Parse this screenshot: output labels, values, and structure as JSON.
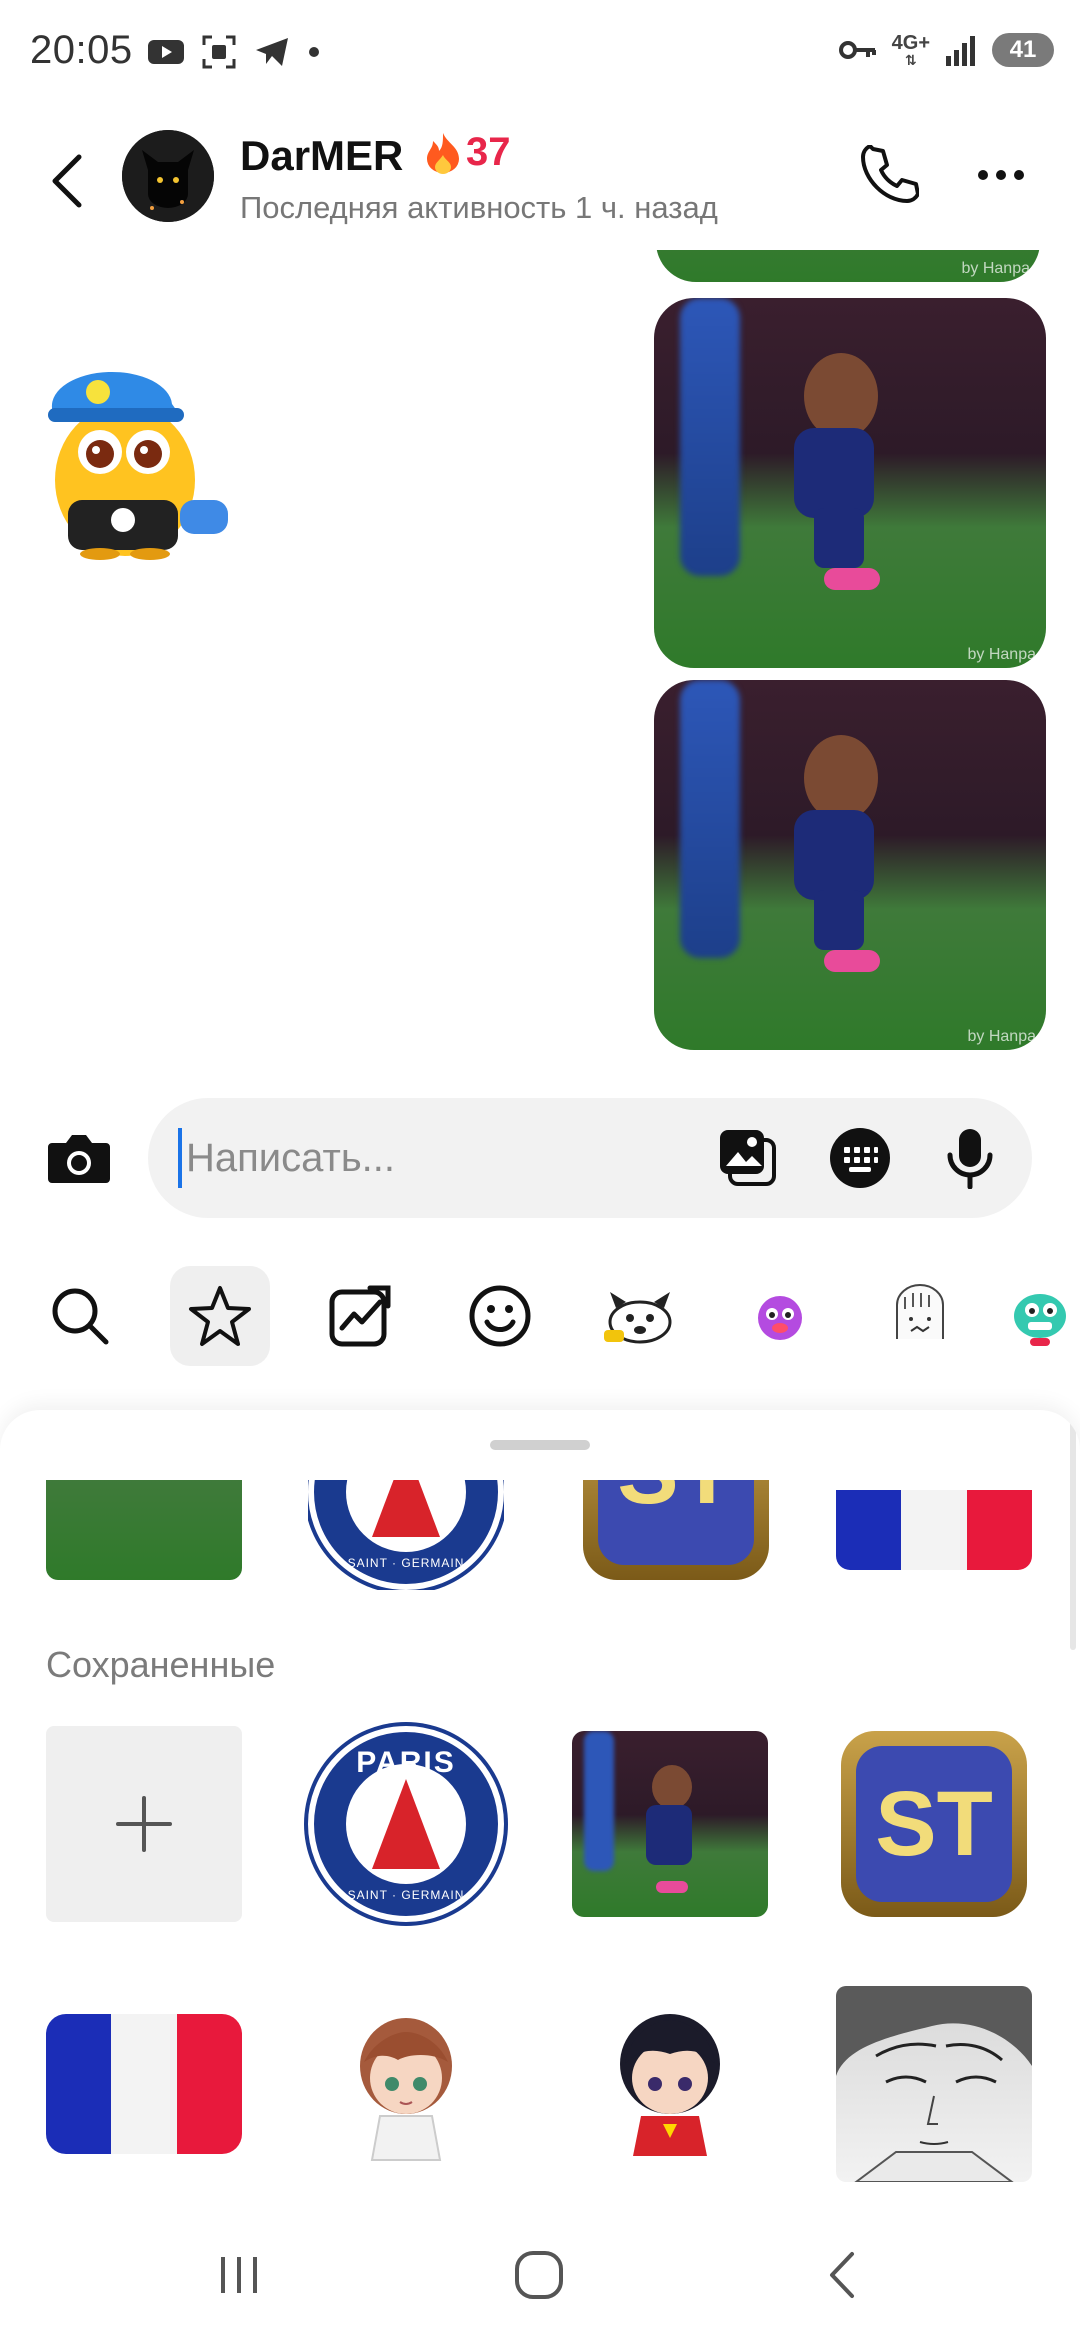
{
  "status_bar": {
    "time": "20:05",
    "network": "4G+",
    "battery": "41"
  },
  "header": {
    "username": "DarMER",
    "streak_count": "37",
    "last_seen": "Последняя активность 1 ч. назад"
  },
  "chat": {
    "photo_credit": "by Hanpa"
  },
  "composer": {
    "placeholder": "Написать..."
  },
  "sticker_panel": {
    "section_title": "Сохраненные",
    "psg_top": "PARIS",
    "psg_bottom": "SAINT · GERMAIN",
    "st_label": "ST",
    "add_label": "+"
  },
  "colors": {
    "streak": "#e8264a",
    "accent_caret": "#1a73e8",
    "section_title": "#7b7b7b"
  }
}
